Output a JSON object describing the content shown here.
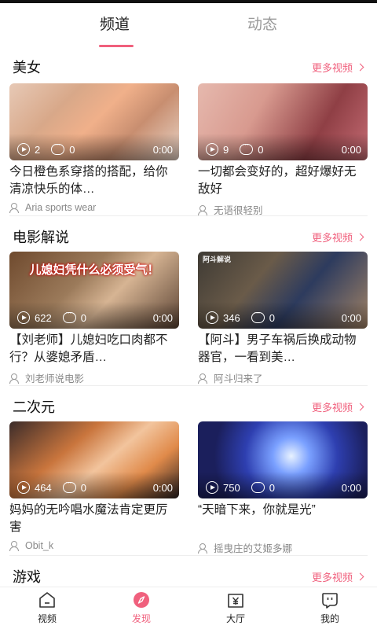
{
  "tabs": [
    "频道",
    "动态"
  ],
  "sections": [
    {
      "title": "美女",
      "more": "更多视频",
      "cards": [
        {
          "plays": "2",
          "comments": "0",
          "duration": "0:00",
          "title": "今日橙色系穿搭的搭配，给你清凉快乐的体…",
          "author": "Aria sports wear"
        },
        {
          "plays": "9",
          "comments": "0",
          "duration": "0:00",
          "title": "一切都会变好的，超好爆好无敌好",
          "author": "无语很轻别"
        }
      ]
    },
    {
      "title": "电影解说",
      "more": "更多视频",
      "cards": [
        {
          "plays": "622",
          "comments": "0",
          "duration": "0:00",
          "title": "【刘老师】儿媳妇吃口肉都不行？从婆媳矛盾…",
          "author": "刘老师说电影",
          "overlay": "儿媳妇凭什么必须受气！"
        },
        {
          "plays": "346",
          "comments": "0",
          "duration": "0:00",
          "title": "【阿斗】男子车祸后换成动物器官，一看到美…",
          "author": "阿斗归来了",
          "overlay": "阿斗解说"
        }
      ]
    },
    {
      "title": "二次元",
      "more": "更多视频",
      "cards": [
        {
          "plays": "464",
          "comments": "0",
          "duration": "0:00",
          "title": "妈妈的无吟唱水魔法肯定更厉害",
          "author": "Obit_k"
        },
        {
          "plays": "750",
          "comments": "0",
          "duration": "0:00",
          "title": "“天暗下来，你就是光”",
          "author": "摇曳庄的艾姬多娜"
        }
      ]
    },
    {
      "title": "游戏",
      "more": "更多视频",
      "cards": []
    }
  ],
  "nav": [
    {
      "label": "视频",
      "icon": "home-icon"
    },
    {
      "label": "发现",
      "icon": "compass-icon"
    },
    {
      "label": "大厅",
      "icon": "yen-icon"
    },
    {
      "label": "我的",
      "icon": "profile-icon"
    }
  ],
  "colors": {
    "accent": "#f0607d"
  }
}
